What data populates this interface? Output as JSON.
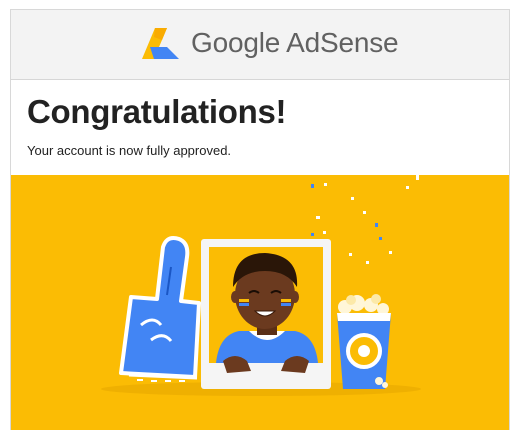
{
  "header": {
    "logo_text": "Google AdSense",
    "logo_icon": "adsense-logo-icon"
  },
  "message": {
    "title": "Congratulations!",
    "body": "Your account is now fully approved."
  },
  "illustration": {
    "description_icon": "celebration-illustration",
    "colors": {
      "background": "#fbbc04",
      "blue": "#4285f4",
      "dark_blue": "#1a56c4",
      "skin": "#6b3a1f",
      "frame": "#f1f1f1"
    }
  }
}
